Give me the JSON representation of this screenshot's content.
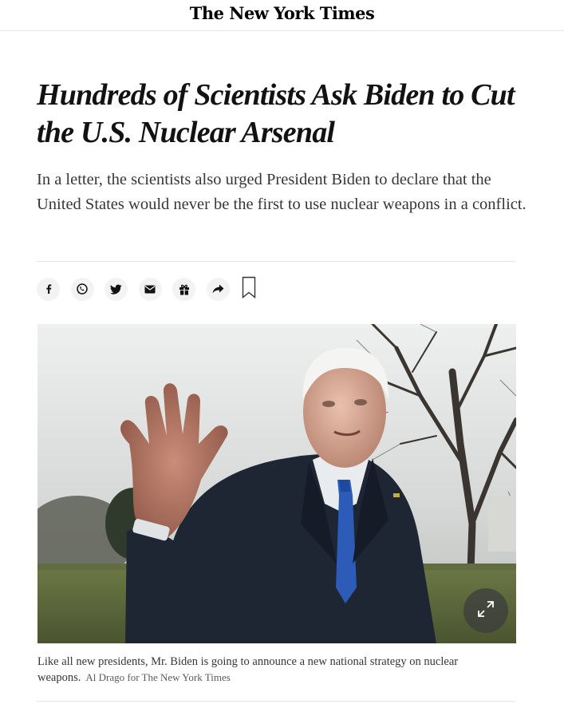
{
  "masthead": {
    "logo_text": "The New York Times"
  },
  "article": {
    "headline": "Hundreds of Scientists Ask Biden to Cut the U.S. Nuclear Arsenal",
    "summary": "In a letter, the scientists also urged President Biden to declare that the United States would never be the first to use nuclear weapons in a conflict."
  },
  "share_tools": {
    "icons": [
      "facebook-icon",
      "whatsapp-icon",
      "twitter-icon",
      "email-icon",
      "gift-icon",
      "share-icon",
      "bookmark-icon"
    ]
  },
  "image": {
    "caption": "Like all new presidents, Mr. Biden is going to announce a new national strategy on nuclear weapons.",
    "credit": "Al Drago for The New York Times",
    "expand_icon": "expand-icon"
  }
}
